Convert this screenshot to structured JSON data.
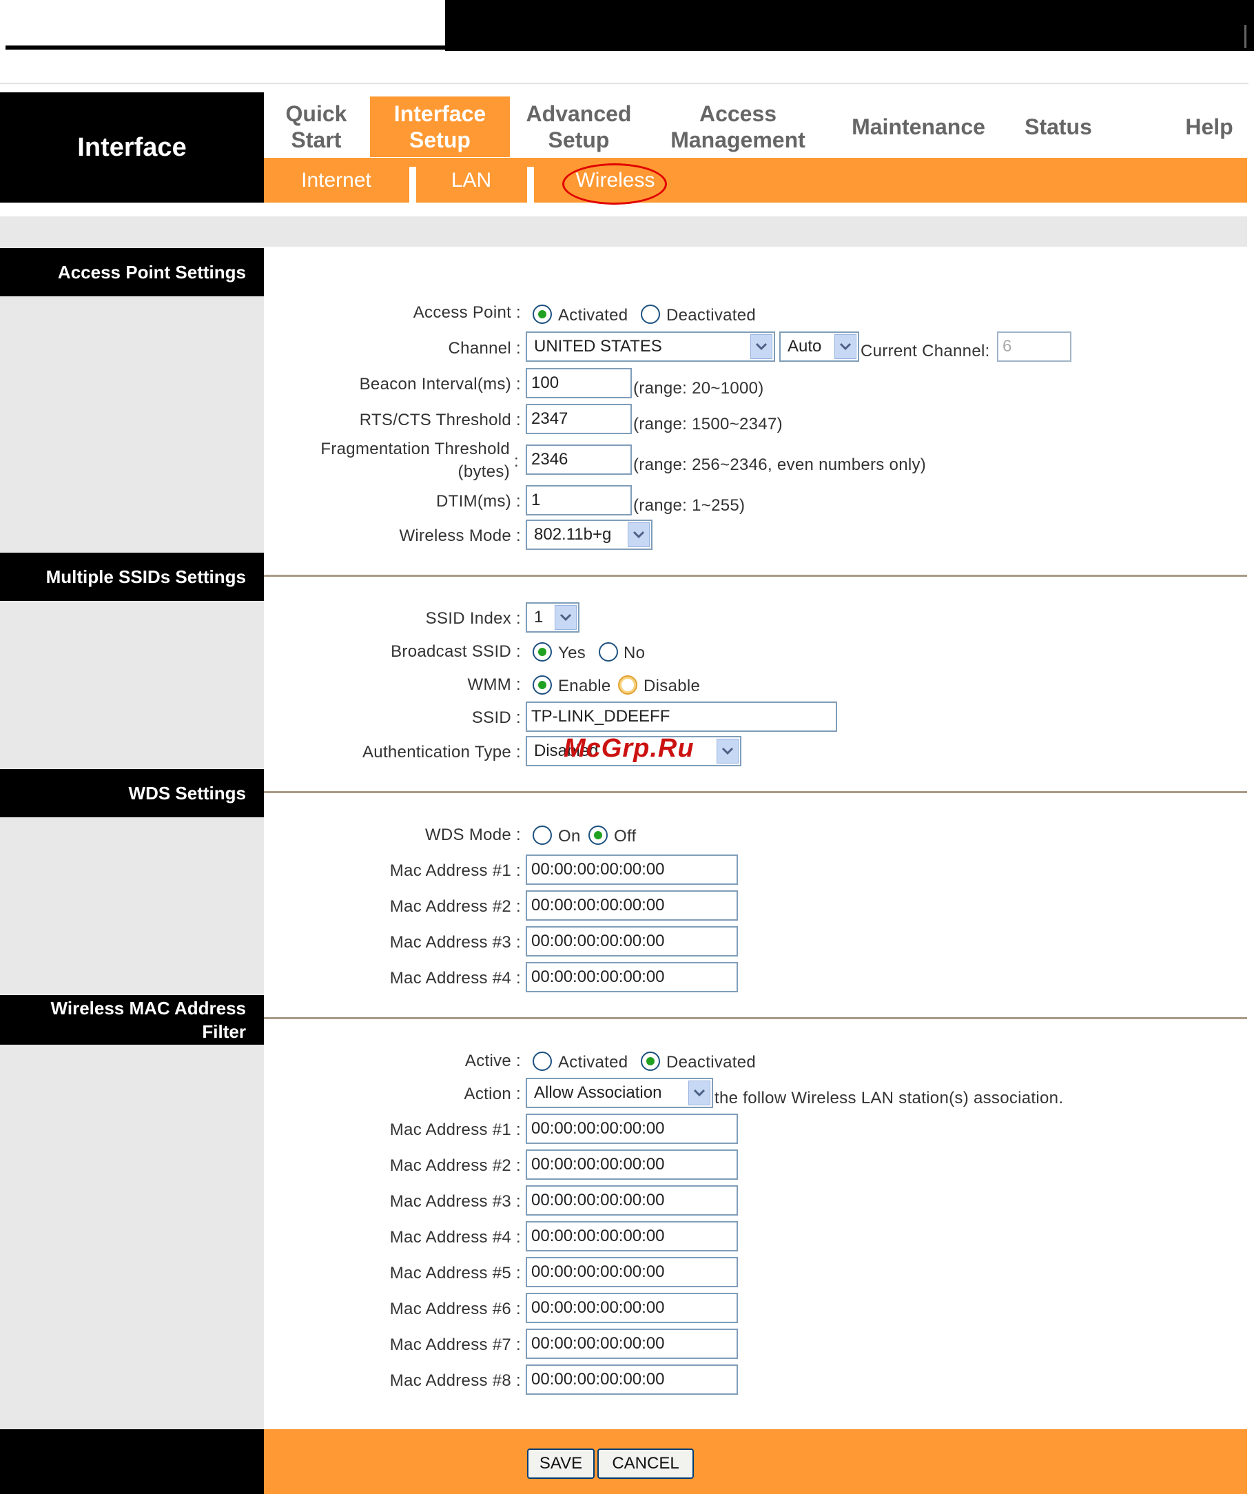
{
  "header": {
    "brand": "Interface"
  },
  "nav": {
    "items": [
      {
        "label_1": "Quick",
        "label_2": "Start"
      },
      {
        "label_1": "Interface",
        "label_2": "Setup"
      },
      {
        "label_1": "Advanced",
        "label_2": "Setup"
      },
      {
        "label_1": "Access",
        "label_2": "Management"
      },
      {
        "label_1": "Maintenance"
      },
      {
        "label_1": "Status"
      },
      {
        "label_1": "Help"
      }
    ],
    "active": "Interface Setup",
    "subitems": [
      "Internet",
      "LAN",
      "Wireless"
    ],
    "active_sub": "Wireless"
  },
  "access_point": {
    "section_title": "Access Point Settings",
    "access_point_label": "Access Point :",
    "activated": "Activated",
    "deactivated": "Deactivated",
    "channel_label": "Channel :",
    "country": "UNITED STATES",
    "channel_mode": "Auto",
    "current_channel_label": "Current Channel:",
    "current_channel": "6",
    "beacon_label": "Beacon Interval(ms) :",
    "beacon_value": "100",
    "beacon_range": "(range: 20~1000)",
    "rts_label": "RTS/CTS Threshold :",
    "rts_value": "2347",
    "rts_range": "(range: 1500~2347)",
    "frag_label_1": "Fragmentation Threshold",
    "frag_label_2": "(bytes)",
    "frag_colon": ":",
    "frag_value": "2346",
    "frag_range": "(range: 256~2346, even numbers only)",
    "dtim_label": "DTIM(ms) :",
    "dtim_value": "1",
    "dtim_range": "(range: 1~255)",
    "mode_label": "Wireless Mode :",
    "mode_value": "802.11b+g"
  },
  "ssid": {
    "section_title": "Multiple SSIDs Settings",
    "index_label": "SSID Index :",
    "index_value": "1",
    "broadcast_label": "Broadcast SSID :",
    "yes": "Yes",
    "no": "No",
    "wmm_label": "WMM :",
    "enable": "Enable",
    "disable": "Disable",
    "ssid_label": "SSID :",
    "ssid_value": "TP-LINK_DDEEFF",
    "auth_label": "Authentication Type :",
    "auth_value": "Disabled"
  },
  "wds": {
    "section_title": "WDS Settings",
    "mode_label": "WDS Mode :",
    "on": "On",
    "off": "Off",
    "macs": [
      {
        "label": "Mac Address #1 :",
        "value": "00:00:00:00:00:00"
      },
      {
        "label": "Mac Address #2 :",
        "value": "00:00:00:00:00:00"
      },
      {
        "label": "Mac Address #3 :",
        "value": "00:00:00:00:00:00"
      },
      {
        "label": "Mac Address #4 :",
        "value": "00:00:00:00:00:00"
      }
    ]
  },
  "mac_filter": {
    "section_title_1": "Wireless MAC Address",
    "section_title_2": "Filter",
    "active_label": "Active :",
    "activated": "Activated",
    "deactivated": "Deactivated",
    "action_label": "Action :",
    "action_value": "Allow Association",
    "action_suffix": "the follow Wireless LAN station(s) association.",
    "macs": [
      {
        "label": "Mac Address #1 :",
        "value": "00:00:00:00:00:00"
      },
      {
        "label": "Mac Address #2 :",
        "value": "00:00:00:00:00:00"
      },
      {
        "label": "Mac Address #3 :",
        "value": "00:00:00:00:00:00"
      },
      {
        "label": "Mac Address #4 :",
        "value": "00:00:00:00:00:00"
      },
      {
        "label": "Mac Address #5 :",
        "value": "00:00:00:00:00:00"
      },
      {
        "label": "Mac Address #6 :",
        "value": "00:00:00:00:00:00"
      },
      {
        "label": "Mac Address #7 :",
        "value": "00:00:00:00:00:00"
      },
      {
        "label": "Mac Address #8 :",
        "value": "00:00:00:00:00:00"
      }
    ]
  },
  "footer": {
    "save": "SAVE",
    "cancel": "CANCEL"
  },
  "watermark": "McGrp.Ru",
  "colors": {
    "accent": "#ff9933",
    "header": "#000000",
    "sidebar": "#e8e8e8",
    "highlight_circle": "#e00000"
  }
}
